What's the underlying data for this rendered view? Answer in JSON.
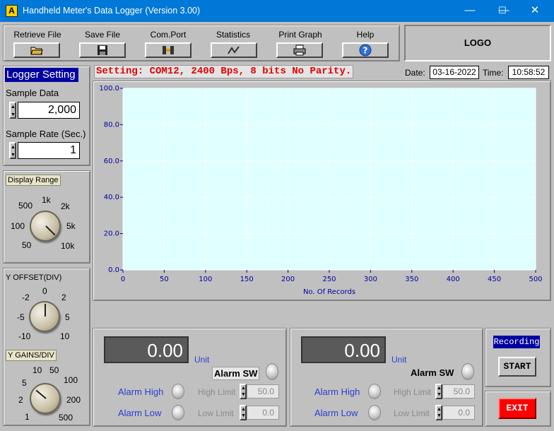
{
  "window": {
    "title": "Handheld Meter's Data Logger (Version 3.00)",
    "app_icon_glyph": "A",
    "minimize": "—",
    "maximize": "☐",
    "close": "✕"
  },
  "toolbar": {
    "retrieve_label": "Retrieve File",
    "save_label": "Save File",
    "comport_label": "Com.Port",
    "stats_label": "Statistics",
    "print_label": "Print Graph",
    "help_label": "Help",
    "icons": [
      "open-folder-icon",
      "floppy-disk-icon",
      "serial-port-icon",
      "chart-statistics-icon",
      "printer-icon",
      "help-icon"
    ]
  },
  "logo": {
    "text": "LOGO"
  },
  "status": {
    "setting_text": "Setting: COM12, 2400 Bps, 8 bits No Parity.",
    "date_label": "Date:",
    "date_value": "03-16-2022",
    "time_label": "Time:",
    "time_value": "10:58:52"
  },
  "logger": {
    "title": "Logger Setting",
    "sample_data_label": "Sample Data",
    "sample_data_value": "2,000",
    "sample_rate_label": "Sample Rate (Sec.)",
    "sample_rate_value": "1"
  },
  "display_range": {
    "label": "Display Range",
    "ticks": [
      "500",
      "1k",
      "2k",
      "100",
      "5k",
      "50",
      "10k"
    ]
  },
  "y_offset": {
    "label": "Y OFFSET(DIV)",
    "ticks": [
      "-2",
      "0",
      "2",
      "-5",
      "5",
      "-10",
      "10"
    ]
  },
  "y_gains": {
    "label": "Y GAINS/DIV",
    "ticks": [
      "10",
      "50",
      "5",
      "100",
      "2",
      "200",
      "1",
      "500"
    ]
  },
  "chart_data": {
    "type": "line",
    "title": "",
    "xlabel": "No. Of Records",
    "ylabel": "",
    "xlim": [
      0,
      500
    ],
    "ylim": [
      0,
      100
    ],
    "xticks": [
      "0",
      "50",
      "100",
      "150",
      "200",
      "250",
      "300",
      "350",
      "400",
      "450",
      "500"
    ],
    "yticks": [
      "0.0",
      "20.0",
      "40.0",
      "60.0",
      "80.0",
      "100.0"
    ],
    "grid": true,
    "series": [],
    "background": "#e0ffff"
  },
  "channel1": {
    "value": "0.00",
    "unit_label": "Unit",
    "alarm_sw_label": "Alarm SW",
    "alarm_high_label": "Alarm High",
    "alarm_low_label": "Alarm Low",
    "high_limit_label": "High Limit",
    "high_limit_value": "50.0",
    "low_limit_label": "Low Limit",
    "low_limit_value": "0.0"
  },
  "channel2": {
    "value": "0.00",
    "unit_label": "Unit",
    "alarm_sw_label": "Alarm SW",
    "alarm_high_label": "Alarm High",
    "alarm_low_label": "Alarm Low",
    "high_limit_label": "High Limit",
    "high_limit_value": "50.0",
    "low_limit_label": "Low Limit",
    "low_limit_value": "0.0"
  },
  "recording": {
    "label": "Recording",
    "start_label": "START",
    "exit_label": "EXIT"
  },
  "colors": {
    "titlebar": "#0078d7",
    "plot_bg": "#e0ffff",
    "setting_text": "#e00000",
    "logger_title_bg": "#0000a0",
    "exit_red": "#ff0000",
    "label_blue": "#2a3fd0"
  }
}
